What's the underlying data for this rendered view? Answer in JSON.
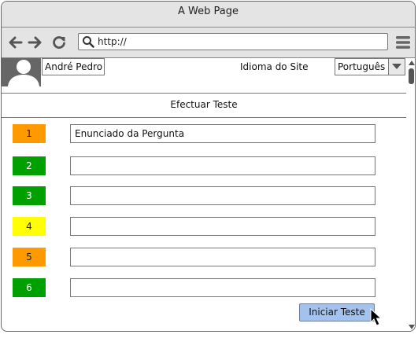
{
  "window": {
    "title": "A Web Page"
  },
  "browser": {
    "url": "http://",
    "icons": [
      "back-arrow-icon",
      "forward-arrow-icon",
      "reload-icon",
      "search-icon",
      "hamburger-menu-icon"
    ]
  },
  "header": {
    "user_name": "André Pedro",
    "language_label": "Idioma do Site",
    "language_selected": "Português"
  },
  "test": {
    "title": "Efectuar Teste",
    "questions": [
      {
        "number": "1",
        "color": "#ff9900",
        "text_color": "#222222",
        "text": "Enunciado da Pergunta"
      },
      {
        "number": "2",
        "color": "#00a000",
        "text_color": "#ffffff",
        "text": ""
      },
      {
        "number": "3",
        "color": "#00a000",
        "text_color": "#ffffff",
        "text": ""
      },
      {
        "number": "4",
        "color": "#ffff00",
        "text_color": "#222222",
        "text": ""
      },
      {
        "number": "5",
        "color": "#ff9900",
        "text_color": "#222222",
        "text": ""
      },
      {
        "number": "6",
        "color": "#00a000",
        "text_color": "#ffffff",
        "text": ""
      }
    ],
    "start_button": "Iniciar Teste",
    "start_button_color": "#a3c2ee"
  }
}
